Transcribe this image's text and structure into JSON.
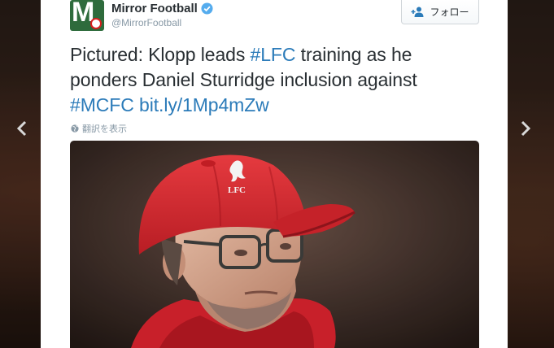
{
  "tweet": {
    "display_name": "Mirror Football",
    "screen_name": "@MirrorFootball",
    "follow_label": "フォロー",
    "text": {
      "part1": "Pictured: Klopp leads ",
      "hashtag_lfc": "#LFC",
      "part2": " training as he ponders Daniel Sturridge inclusion against ",
      "hashtag_mcfc": "#MCFC",
      "link": "bit.ly/1Mp4mZw"
    },
    "translate_label": "翻訳を表示",
    "cap_logo_text": "LFC"
  },
  "icons": {
    "verified": "verified-badge-icon",
    "follow": "add-user-icon",
    "translate": "globe-icon",
    "prev": "chevron-left-icon",
    "next": "chevron-right-icon"
  },
  "colors": {
    "link": "#2b7bb9",
    "verified": "#55acee",
    "text": "#292f33",
    "muted": "#8899a6",
    "cap": "#d8232a"
  }
}
